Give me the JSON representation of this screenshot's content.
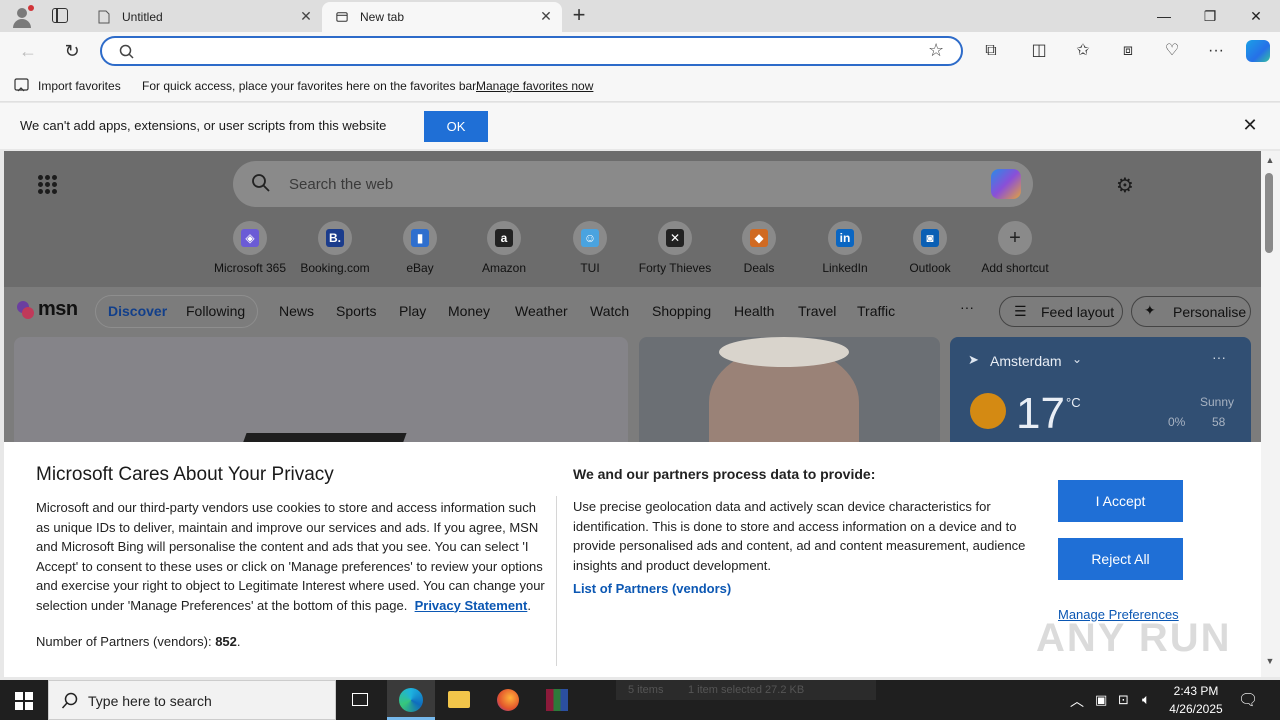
{
  "browser": {
    "tabs": [
      {
        "title": "Untitled",
        "active": false
      },
      {
        "title": "New tab",
        "active": true
      }
    ],
    "address": {
      "value": "",
      "placeholder": ""
    },
    "favorites_bar": {
      "import_label": "Import favorites",
      "hint": "For quick access, place your favorites here on the favorites bar.",
      "manage_link": "Manage favorites now"
    },
    "infobar": {
      "message": "We can't add apps, extensions, or user scripts from this website",
      "ok_label": "OK"
    }
  },
  "newtab": {
    "search_placeholder": "Search the web",
    "shortcuts": [
      {
        "label": "Microsoft 365",
        "color": "#6b5bd6"
      },
      {
        "label": "Booking.com",
        "color": "#1b3c8c"
      },
      {
        "label": "eBay",
        "color": "#2f6fce"
      },
      {
        "label": "Amazon",
        "color": "#222222"
      },
      {
        "label": "TUI",
        "color": "#4aa3df"
      },
      {
        "label": "Forty Thieves",
        "color": "#222222"
      },
      {
        "label": "Deals",
        "color": "#d06a22"
      },
      {
        "label": "LinkedIn",
        "color": "#0a66c2"
      },
      {
        "label": "Outlook",
        "color": "#0a5fb4"
      },
      {
        "label": "Add shortcut",
        "color": "#8a8a8a"
      }
    ],
    "msn": {
      "logo": "msn",
      "pill_items": [
        "Discover",
        "Following"
      ],
      "nav_items": [
        "News",
        "Sports",
        "Play",
        "Money",
        "Weather",
        "Watch",
        "Shopping",
        "Health",
        "Travel",
        "Traffic"
      ],
      "more": "···",
      "feed_layout": "Feed layout",
      "personalise": "Personalise"
    },
    "weather": {
      "location": "Amsterdam",
      "temp": "17",
      "unit": "°C",
      "condition": "Sunny",
      "rain": "0%",
      "wind": "58"
    }
  },
  "privacy": {
    "title": "Microsoft Cares About Your Privacy",
    "body_pre": "Microsoft and our third-party vendors use cookies to store and access information such as unique IDs to deliver, maintain and improve our services and ads. If you agree, MSN and Microsoft Bing will personalise the content and ads that you see. You can select 'I Accept' to consent to these uses or click on 'Manage preferences' to review your options and exercise your right to object to Legitimate Interest where used.  You can change your selection under 'Manage Preferences' at the bottom of this page.",
    "privacy_link": "Privacy Statement",
    "partners_label": "Number of Partners (vendors):",
    "partners_count": "852",
    "process_title": "We and our partners process data to provide:",
    "process_body": "Use precise geolocation data and actively scan device characteristics for identification. This is done to store and access information on a device and to provide personalised ads and content, ad and content measurement, audience insights and product development.",
    "vendors_link": "List of Partners (vendors)",
    "accept": "I Accept",
    "reject": "Reject All",
    "manage": "Manage Preferences"
  },
  "watermark": "ANY RUN",
  "taskbar": {
    "search_placeholder": "Type here to search",
    "ghost_left": "5 items",
    "ghost_right": "1 item selected  27.2 KB",
    "time": "2:43 PM",
    "date": "4/26/2025"
  }
}
